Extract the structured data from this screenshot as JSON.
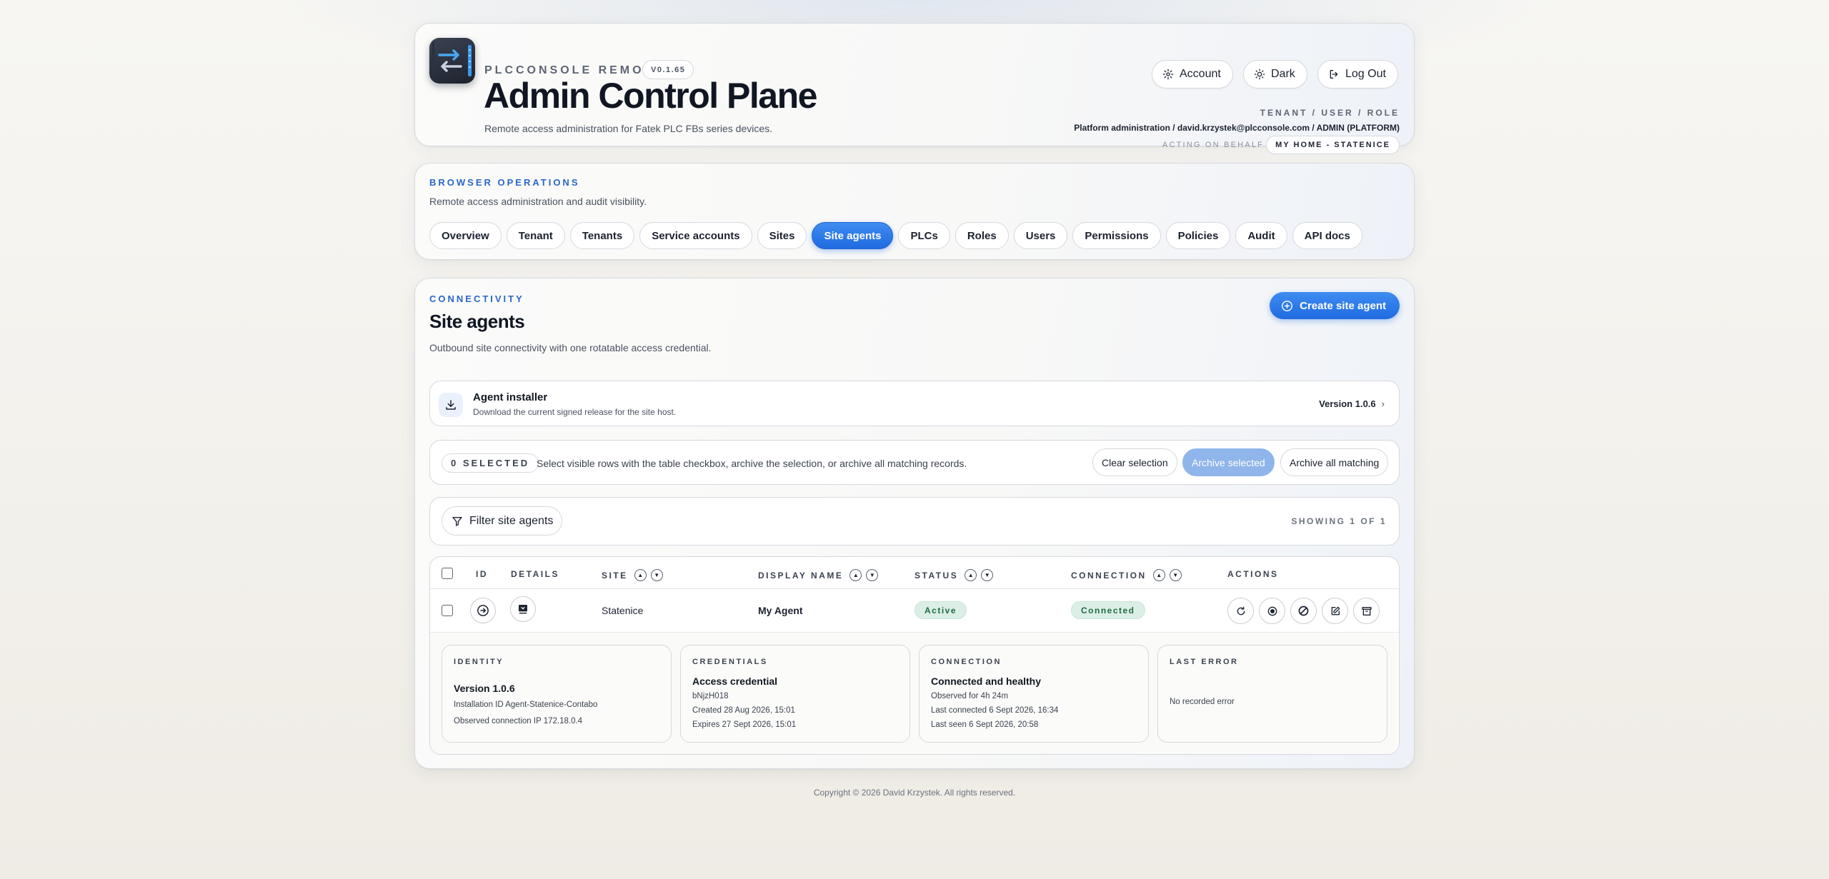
{
  "app": {
    "name": "PLCCONSOLE REMOTE",
    "version": "V0.1.65",
    "title": "Admin Control Plane",
    "subtitle": "Remote access administration for Fatek PLC FBs series devices."
  },
  "header_actions": {
    "account": "Account",
    "dark": "Dark",
    "logout": "Log Out"
  },
  "session": {
    "label": "TENANT / USER / ROLE",
    "value": "Platform administration / david.krzystek@plcconsole.com / ADMIN (PLATFORM)",
    "acting_label": "ACTING ON BEHALF OF",
    "acting_value": "MY HOME - STATENICE"
  },
  "ops": {
    "eyebrow": "BROWSER OPERATIONS",
    "description": "Remote access administration and audit visibility.",
    "tabs": [
      {
        "label": "Overview",
        "active": false
      },
      {
        "label": "Tenant",
        "active": false
      },
      {
        "label": "Tenants",
        "active": false
      },
      {
        "label": "Service accounts",
        "active": false
      },
      {
        "label": "Sites",
        "active": false
      },
      {
        "label": "Site agents",
        "active": true
      },
      {
        "label": "PLCs",
        "active": false
      },
      {
        "label": "Roles",
        "active": false
      },
      {
        "label": "Users",
        "active": false
      },
      {
        "label": "Permissions",
        "active": false
      },
      {
        "label": "Policies",
        "active": false
      },
      {
        "label": "Audit",
        "active": false
      },
      {
        "label": "API docs",
        "active": false
      }
    ]
  },
  "page": {
    "eyebrow": "CONNECTIVITY",
    "title": "Site agents",
    "description": "Outbound site connectivity with one rotatable access credential.",
    "create_button": "Create site agent"
  },
  "installer": {
    "title": "Agent installer",
    "subtitle": "Download the current signed release for the site host.",
    "version": "Version 1.0.6",
    "chevron": "›"
  },
  "selection": {
    "count": "0 SELECTED",
    "text": "Select visible rows with the table checkbox, archive the selection, or archive all matching records.",
    "clear": "Clear selection",
    "archive_selected": "Archive selected",
    "archive_all": "Archive all matching"
  },
  "filter": {
    "button": "Filter site agents",
    "showing": "SHOWING 1 OF 1"
  },
  "table": {
    "columns": {
      "id": "ID",
      "details": "DETAILS",
      "site": "SITE",
      "display_name": "DISPLAY NAME",
      "status": "STATUS",
      "connection": "CONNECTION",
      "actions": "ACTIONS"
    },
    "rows": [
      {
        "site": "Statenice",
        "display_name": "My Agent",
        "status": "Active",
        "connection": "Connected"
      }
    ]
  },
  "details": {
    "identity": {
      "label": "IDENTITY",
      "title": "Version 1.0.6",
      "lines": [
        "Installation ID Agent-Statenice-Contabo",
        "Observed connection IP 172.18.0.4"
      ]
    },
    "credentials": {
      "label": "CREDENTIALS",
      "title": "Access credential",
      "lines": [
        "bNjzH018",
        "Created 28 Aug 2026, 15:01",
        "Expires 27 Sept 2026, 15:01"
      ]
    },
    "connection": {
      "label": "CONNECTION",
      "title": "Connected and healthy",
      "lines": [
        "Observed for 4h 24m",
        "Last connected 6 Sept 2026, 16:34",
        "Last seen 6 Sept 2026, 20:58"
      ]
    },
    "last_error": {
      "label": "LAST ERROR",
      "lines": [
        "No recorded error"
      ]
    }
  },
  "footer": "Copyright © 2026 David Krzystek. All rights reserved.",
  "colors": {
    "accent": "#1f6be0",
    "accent_light": "#3f8cf2",
    "eyebrow": "#2a67c8",
    "success_bg": "#dcefe6",
    "success_text": "#1e6b46"
  }
}
